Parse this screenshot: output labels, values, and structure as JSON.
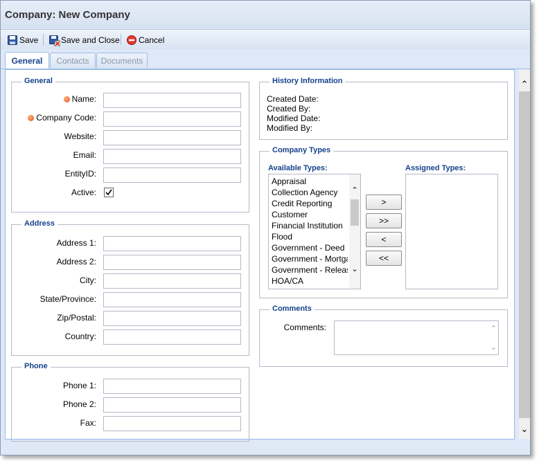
{
  "window": {
    "title": "Company: New Company"
  },
  "toolbar": {
    "save": "Save",
    "save_close": "Save and Close",
    "cancel": "Cancel"
  },
  "tabs": [
    "General",
    "Contacts",
    "Documents"
  ],
  "general": {
    "legend": "General",
    "fields": [
      "Name:",
      "Company Code:",
      "Website:",
      "Email:",
      "EntityID:",
      "Active:"
    ],
    "active_checked": true
  },
  "address": {
    "legend": "Address",
    "fields": [
      "Address 1:",
      "Address 2:",
      "City:",
      "State/Province:",
      "Zip/Postal:",
      "Country:"
    ]
  },
  "phone": {
    "legend": "Phone",
    "fields": [
      "Phone 1:",
      "Phone 2:",
      "Fax:"
    ]
  },
  "history": {
    "legend": "History Information",
    "created_date": "Created Date:",
    "created_by": "Created By:",
    "modified_date": "Modified Date:",
    "modified_by": "Modified By:"
  },
  "company_types": {
    "legend": "Company Types",
    "available_label": "Available Types:",
    "assigned_label": "Assigned Types:",
    "available": [
      "Appraisal",
      "Collection Agency",
      "Credit Reporting",
      "Customer",
      "Financial Institution",
      "Flood",
      "Government - Deed",
      "Government - Mortgage",
      "Government - Release",
      "HOA/CA"
    ],
    "buttons": [
      ">",
      ">>",
      "<",
      "<<"
    ]
  },
  "comments": {
    "legend": "Comments",
    "label": "Comments:"
  }
}
